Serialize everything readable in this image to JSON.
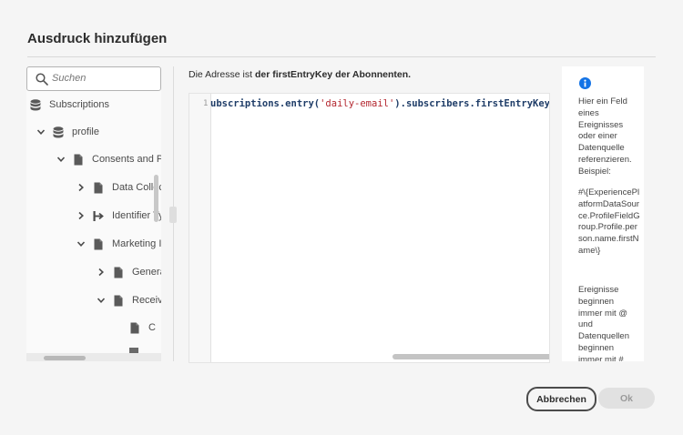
{
  "dialog": {
    "title": "Ausdruck hinzufügen"
  },
  "search": {
    "placeholder": "Suchen"
  },
  "tree": {
    "items": [
      {
        "label": "Subscriptions",
        "icon": "database-icon",
        "expanded": null
      },
      {
        "label": "profile",
        "icon": "database-icon",
        "expanded": true
      },
      {
        "label": "Consents and Pr",
        "icon": "document-icon",
        "expanded": true
      },
      {
        "label": "Data Collec",
        "icon": "document-icon",
        "expanded": false
      },
      {
        "label": "Identifier Ty",
        "icon": "identifier-icon",
        "expanded": false
      },
      {
        "label": "Marketing I",
        "icon": "document-icon",
        "expanded": true
      },
      {
        "label": "Genera",
        "icon": "document-icon",
        "expanded": false
      },
      {
        "label": "Receiv",
        "icon": "document-icon",
        "expanded": true
      },
      {
        "label": "C",
        "icon": "document-icon",
        "expanded": null
      }
    ]
  },
  "description": {
    "prefix": "Die Adresse ist ",
    "bold": "der firstEntryKey der Abonnenten."
  },
  "editor": {
    "line_number": "1",
    "code_prefix": "ubscriptions.entry(",
    "code_string": "'daily-email'",
    "code_suffix": ").subscribers.firstEntryKey()}"
  },
  "help": {
    "paragraph1": "Hier ein Feld eines Ereignisses oder einer Datenquelle referenzieren. Beispiel:",
    "paragraph2": "#\\{ExperiencePlatformDataSource.ProfileFieldGroup.Profile.person.name.firstName\\}",
    "paragraph3": "Ereignisse beginnen immer mit @ und Datenquellen beginnen immer mit #."
  },
  "buttons": {
    "cancel": "Abbrechen",
    "ok": "Ok"
  },
  "colors": {
    "accent_info": "#1473e6",
    "code_keyword": "#1f3d68",
    "code_string": "#b3262e"
  }
}
